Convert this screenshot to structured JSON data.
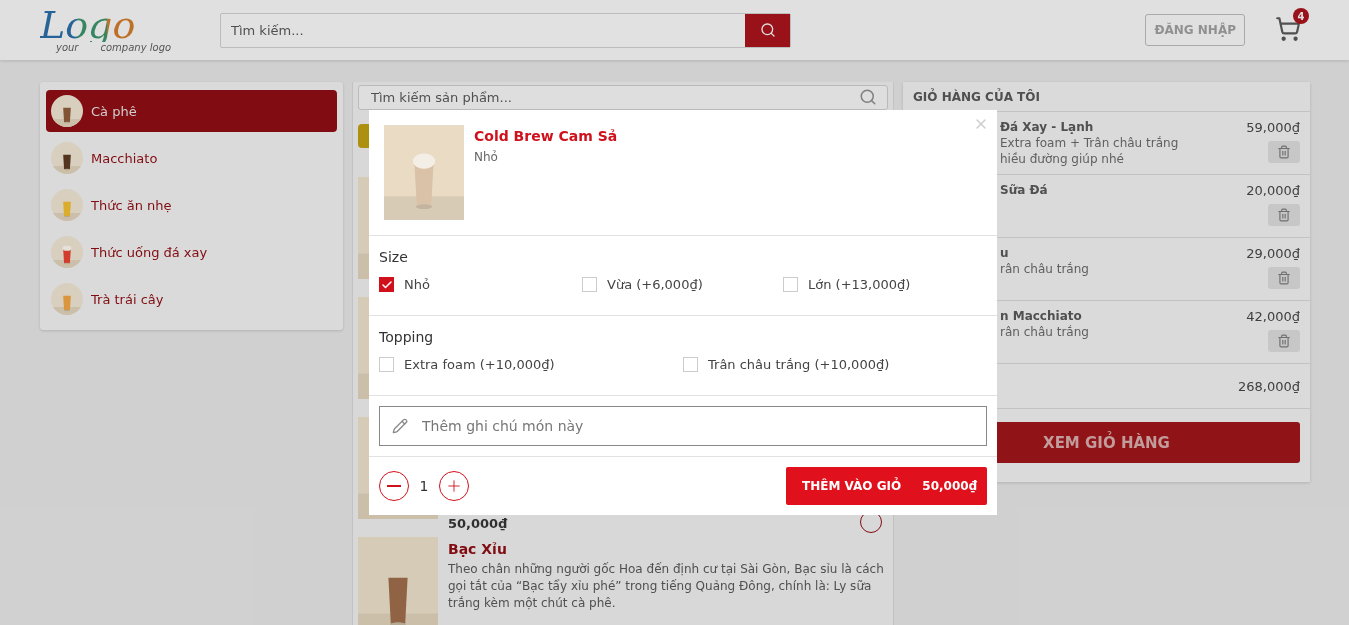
{
  "header": {
    "logo": {
      "word": "Logo",
      "tagline_left": "your",
      "tagline_right": "company logo"
    },
    "search": {
      "placeholder": "Tìm kiếm..."
    },
    "login_button": "ĐĂNG NHẬP",
    "cart_count": "4"
  },
  "categories": [
    {
      "label": "Cà phê",
      "selected": true
    },
    {
      "label": "Macchiato",
      "selected": false
    },
    {
      "label": "Thức ăn nhẹ",
      "selected": false
    },
    {
      "label": "Thức uống đá xay",
      "selected": false
    },
    {
      "label": "Trà trái cây",
      "selected": false
    }
  ],
  "products": {
    "search": {
      "placeholder": "Tìm kiếm sản phẩm..."
    },
    "items": [
      {
        "kind": "picture"
      },
      {
        "kind": "picture"
      },
      {
        "kind": "picture",
        "price": "50,000₫"
      },
      {
        "kind": "picture",
        "name": "Bạc Xỉu",
        "description": "Theo chân những người gốc Hoa đến định cư tại Sài Gòn, Bạc sỉu là cách gọi tắt của “Bạc tẩy xỉu phé” trong tiếng Quảng Đông, chính là: Ly sữa trắng kèm một chút cà phê."
      }
    ]
  },
  "cart": {
    "title": "GIỎ HÀNG CỦA TÔI",
    "items": [
      {
        "name": "Đá Xay - Lạnh",
        "details": [
          "Extra foam + Trân châu trắng",
          "hiều đường giúp nhé"
        ],
        "price": "59,000₫"
      },
      {
        "name": "Sữa Đá",
        "price": "20,000₫"
      },
      {
        "name": "u",
        "details": [
          "rân châu trắng"
        ],
        "price": "29,000₫"
      },
      {
        "name": "n Macchiato",
        "details": [
          "rân châu trắng"
        ],
        "price": "42,000₫"
      }
    ],
    "total": "268,000₫",
    "view_button": "XEM GIỎ HÀNG"
  },
  "modal": {
    "title": "Cold Brew Cam Sả",
    "subtitle": "Nhỏ",
    "sections": [
      {
        "title": "Size",
        "options": [
          {
            "label": "Nhỏ",
            "checked": true
          },
          {
            "label": "Vừa (+6,000₫)",
            "checked": false
          },
          {
            "label": "Lớn (+13,000₫)",
            "checked": false
          }
        ]
      },
      {
        "title": "Topping",
        "options": [
          {
            "label": "Extra foam (+10,000₫)",
            "checked": false
          },
          {
            "label": "Trân châu trắng (+10,000₫)",
            "checked": false
          }
        ]
      }
    ],
    "note": {
      "placeholder": "Thêm ghi chú món này"
    },
    "quantity": "1",
    "add_button": "THÊM VÀO GIỎ",
    "add_price": "50,000₫"
  }
}
